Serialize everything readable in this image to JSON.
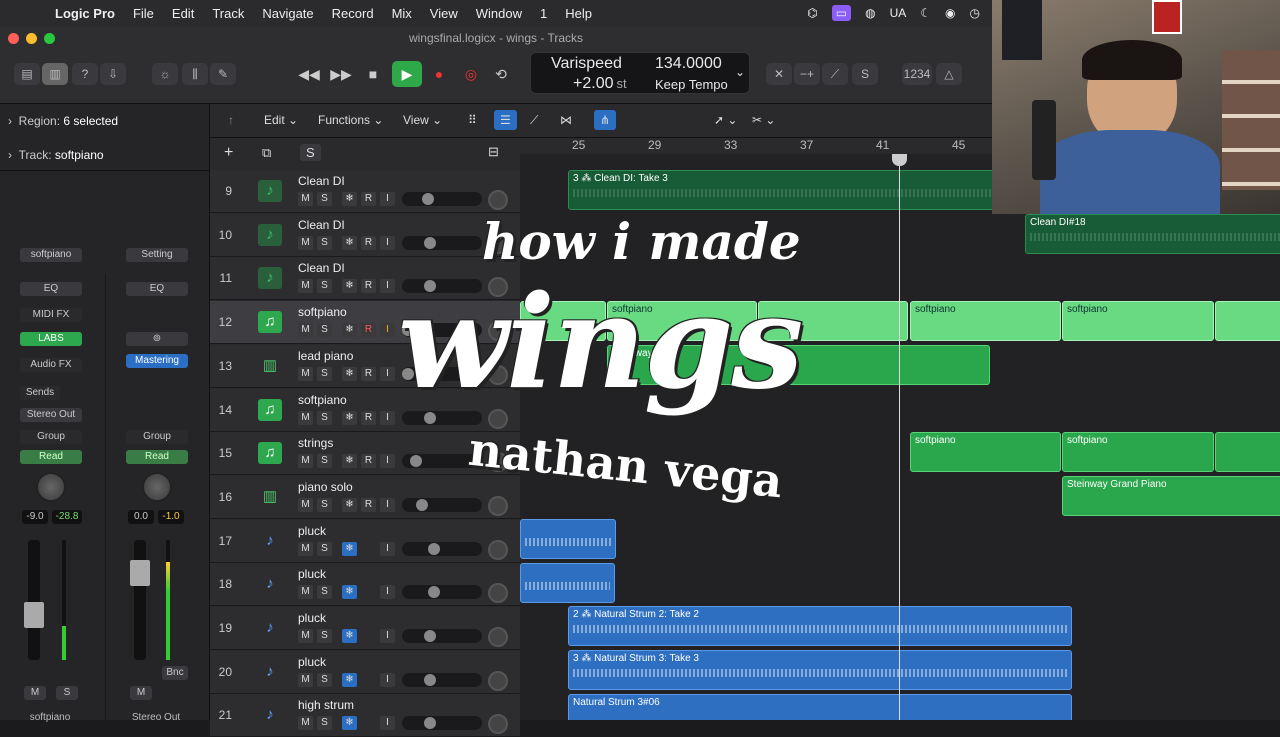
{
  "menubar": {
    "app": "Logic Pro",
    "items": [
      "File",
      "Edit",
      "Track",
      "Navigate",
      "Record",
      "Mix",
      "View",
      "Window",
      "1",
      "Help"
    ],
    "lang": "UA"
  },
  "window": {
    "title": "wingsfinal.logicx - wings - Tracks"
  },
  "lcd": {
    "mode": "Varispeed",
    "semitones": "+2.00",
    "unit": "st",
    "tempo": "134.0000",
    "tempo_mode": "Keep Tempo",
    "key": "1234"
  },
  "inspector": {
    "region_label": "Region:",
    "region_value": "6 selected",
    "track_label": "Track:",
    "track_value": "softpiano"
  },
  "strip1": {
    "name": "softpiano",
    "eq": "EQ",
    "midifx": "MIDI FX",
    "plugin": "LABS",
    "audiofx": "Audio FX",
    "sends": "Sends",
    "output": "Stereo Out",
    "group": "Group",
    "auto": "Read",
    "vol": "-9.0",
    "peak": "-28.8",
    "m": "M",
    "s": "S",
    "footer": "softpiano"
  },
  "strip2": {
    "name": "Setting",
    "eq": "EQ",
    "plugin": "Mastering",
    "group": "Group",
    "auto": "Read",
    "vol": "0.0",
    "peak": "-1.0",
    "m": "M",
    "bnc": "Bnc",
    "footer": "Stereo Out"
  },
  "trackbar": {
    "edit": "Edit",
    "functions": "Functions",
    "view": "View"
  },
  "ruler": [
    "25",
    "29",
    "33",
    "37",
    "41",
    "45"
  ],
  "tracks": [
    {
      "num": "9",
      "name": "Clean DI",
      "kind": "audio-guitar"
    },
    {
      "num": "10",
      "name": "Clean DI",
      "kind": "audio-guitar"
    },
    {
      "num": "11",
      "name": "Clean DI",
      "kind": "audio-guitar"
    },
    {
      "num": "12",
      "name": "softpiano",
      "kind": "midi"
    },
    {
      "num": "13",
      "name": "lead piano",
      "kind": "piano"
    },
    {
      "num": "14",
      "name": "softpiano",
      "kind": "midi"
    },
    {
      "num": "15",
      "name": "strings",
      "kind": "midi"
    },
    {
      "num": "16",
      "name": "piano solo",
      "kind": "piano"
    },
    {
      "num": "17",
      "name": "pluck",
      "kind": "guitar"
    },
    {
      "num": "18",
      "name": "pluck",
      "kind": "guitar"
    },
    {
      "num": "19",
      "name": "pluck",
      "kind": "guitar"
    },
    {
      "num": "20",
      "name": "pluck",
      "kind": "guitar"
    },
    {
      "num": "21",
      "name": "high strum",
      "kind": "guitar"
    }
  ],
  "track_buttons": {
    "m": "M",
    "s": "S",
    "f": "❄",
    "r": "R",
    "i": "I"
  },
  "regions": {
    "clean_take": "3 ⁂ Clean DI: Take 3",
    "clean18": "Clean DI#18",
    "softpiano": "softpiano",
    "leadpiano": "Steinway Pi",
    "steinway": "Steinway Grand Piano",
    "strum2": "2 ⁂ Natural Strum 2: Take 2",
    "strum3": "3 ⁂ Natural Strum 3: Take 3",
    "strum306": "Natural Strum 3#06"
  },
  "overlay": {
    "line1": "how i made",
    "line2": "wings",
    "line3": "nathan vega"
  }
}
